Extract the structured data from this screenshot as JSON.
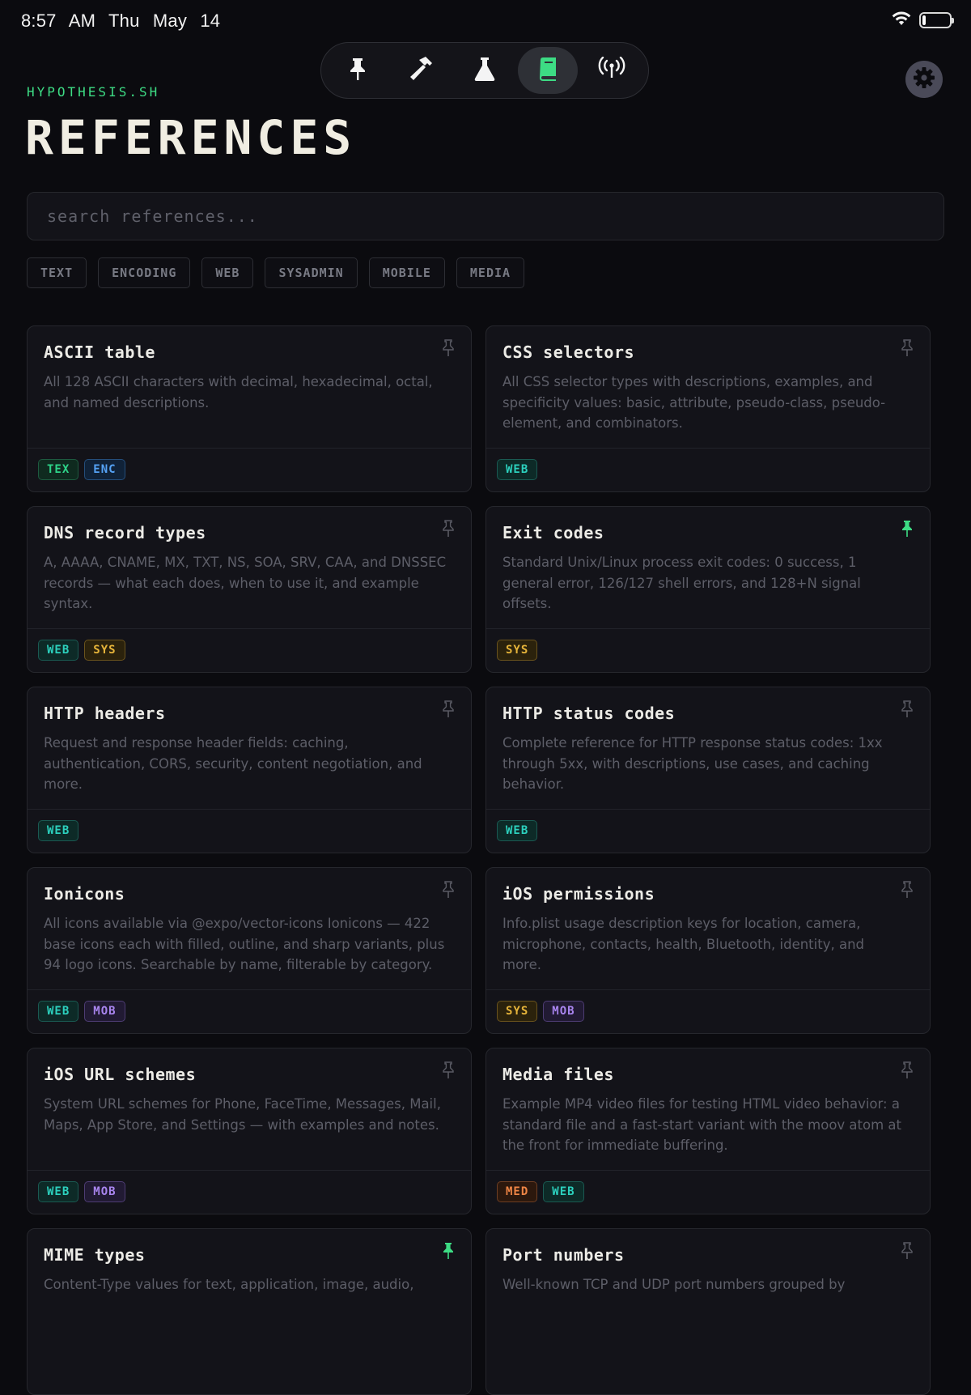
{
  "status_bar": {
    "time": "8:57 AM",
    "date": "Thu May 14",
    "wifi_icon": "wifi-icon",
    "battery_icon": "battery-icon"
  },
  "toolbar": {
    "items": [
      {
        "icon": "pin-icon",
        "active": false
      },
      {
        "icon": "hammer-icon",
        "active": false
      },
      {
        "icon": "flask-icon",
        "active": false
      },
      {
        "icon": "book-icon",
        "active": true
      },
      {
        "icon": "broadcast-icon",
        "active": false
      }
    ],
    "settings_icon": "gear-icon"
  },
  "header": {
    "brand": "HYPOTHESIS.SH",
    "title": "REFERENCES"
  },
  "search": {
    "placeholder": "search references...",
    "value": ""
  },
  "filters": [
    "TEXT",
    "ENCODING",
    "WEB",
    "SYSADMIN",
    "MOBILE",
    "MEDIA"
  ],
  "colors": {
    "accent": "#3ddc84",
    "background": "#0b0b0f",
    "card": "#131319"
  },
  "cards": [
    {
      "title": "ASCII table",
      "description": "All 128 ASCII characters with decimal, hexadecimal, octal, and named descriptions.",
      "tags": [
        "TEX",
        "ENC"
      ],
      "pinned": false
    },
    {
      "title": "CSS selectors",
      "description": "All CSS selector types with descriptions, examples, and specificity values: basic, attribute, pseudo-class, pseudo-element, and combinators.",
      "tags": [
        "WEB"
      ],
      "pinned": false
    },
    {
      "title": "DNS record types",
      "description": "A, AAAA, CNAME, MX, TXT, NS, SOA, SRV, CAA, and DNSSEC records — what each does, when to use it, and example syntax.",
      "tags": [
        "WEB",
        "SYS"
      ],
      "pinned": false
    },
    {
      "title": "Exit codes",
      "description": "Standard Unix/Linux process exit codes: 0 success, 1 general error, 126/127 shell errors, and 128+N signal offsets.",
      "tags": [
        "SYS"
      ],
      "pinned": true
    },
    {
      "title": "HTTP headers",
      "description": "Request and response header fields: caching, authentication, CORS, security, content negotiation, and more.",
      "tags": [
        "WEB"
      ],
      "pinned": false
    },
    {
      "title": "HTTP status codes",
      "description": "Complete reference for HTTP response status codes: 1xx through 5xx, with descriptions, use cases, and caching behavior.",
      "tags": [
        "WEB"
      ],
      "pinned": false
    },
    {
      "title": "Ionicons",
      "description": "All icons available via @expo/vector-icons Ionicons — 422 base icons each with filled, outline, and sharp variants, plus 94 logo icons. Searchable by name, filterable by category.",
      "tags": [
        "WEB",
        "MOB"
      ],
      "pinned": false
    },
    {
      "title": "iOS permissions",
      "description": "Info.plist usage description keys for location, camera, microphone, contacts, health, Bluetooth, identity, and more.",
      "tags": [
        "SYS",
        "MOB"
      ],
      "pinned": false
    },
    {
      "title": "iOS URL schemes",
      "description": "System URL schemes for Phone, FaceTime, Messages, Mail, Maps, App Store, and Settings — with examples and notes.",
      "tags": [
        "WEB",
        "MOB"
      ],
      "pinned": false
    },
    {
      "title": "Media files",
      "description": "Example MP4 video files for testing HTML video behavior: a standard file and a fast-start variant with the moov atom at the front for immediate buffering.",
      "tags": [
        "MED",
        "WEB"
      ],
      "pinned": false
    },
    {
      "title": "MIME types",
      "description": "Content-Type values for text, application, image, audio,",
      "tags": [],
      "pinned": true
    },
    {
      "title": "Port numbers",
      "description": "Well-known TCP and UDP port numbers grouped by",
      "tags": [],
      "pinned": false
    }
  ]
}
